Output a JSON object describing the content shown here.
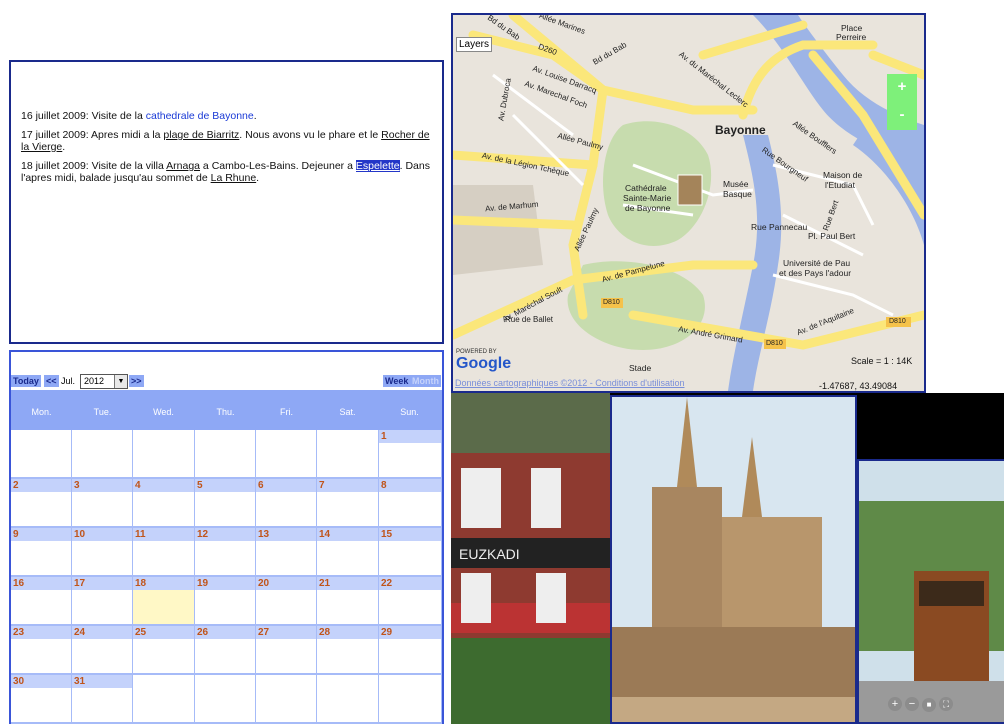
{
  "journal": {
    "entries": [
      {
        "date": "16 juillet 2009:",
        "text": " Visite de la ",
        "link": "cathedrale de Bayonne",
        "after": "."
      },
      {
        "date": "17 juillet 2009:",
        "text": " Apres midi a la ",
        "link": "plage de Biarritz",
        "after": ". Nous avons vu le phare et le ",
        "link2": "Rocher de la Vierge",
        "after2": "."
      },
      {
        "date": "18 juillet 2009:",
        "text": " Visite de la villa ",
        "link": "Arnaga",
        "after": " a Cambo-Les-Bains. Dejeuner a ",
        "link2": "Espelette",
        "after2": ". Dans l'apres midi, balade jusqu'au sommet de ",
        "link3": "La Rhune",
        "after3": "."
      }
    ]
  },
  "map": {
    "layers_label": "Layers",
    "zoom_in": "+",
    "zoom_out": "-",
    "powered_by": "POWERED BY",
    "google": "Google",
    "scale": "Scale = 1 : 14K",
    "coords": "-1.47687, 43.49084",
    "data_credit": "Données cartographiques ©2012 - Conditions d'utilisation",
    "labels": {
      "city": "Bayonne",
      "place": "Place",
      "perreire": "Perreire",
      "cathedrale": "Cathédrale",
      "sainte_marie": "Sainte-Marie",
      "de_bayonne": "de Bayonne",
      "musee": "Musée",
      "basque": "Basque",
      "maison": "Maison de",
      "etudiant": "l'Etudiat",
      "universite": "Université de Pau",
      "pays": "et des Pays l'adour",
      "stade": "Stade",
      "rue_pannecau": "Rue Pannecau",
      "pl_paul_bert": "Pl. Paul Bert"
    },
    "roads": [
      "Bd du Bab",
      "Allée Marines",
      "Bd du Bab",
      "Av. du Maréchal Leclerc",
      "Av. Louise Darracq",
      "Av. Marechal Foch",
      "Allée Paulmy",
      "Av. de la Légion Tchèque",
      "Av. de Marhum",
      "Allée Paulmy",
      "Av. de Pampelune",
      "Av. Maréchal Soult",
      "Rue de Ballet",
      "Av. André Grimard",
      "Av. de l'Aquitaine",
      "Allée Boufflers",
      "Rue Bourgneuf",
      "Rue Bert",
      "D810",
      "D810",
      "D810",
      "D260",
      "Av. Dubroca"
    ]
  },
  "calendar": {
    "today": "Today",
    "prev": "<<",
    "month": "Jul.",
    "year": "2012",
    "next": ">>",
    "week": "Week",
    "month_btn": "Month",
    "weekdays": [
      "Mon.",
      "Tue.",
      "Wed.",
      "Thu.",
      "Fri.",
      "Sat.",
      "Sun."
    ],
    "weeks": [
      [
        "",
        "",
        "",
        "",
        "",
        "",
        "1"
      ],
      [
        "2",
        "3",
        "4",
        "5",
        "6",
        "7",
        "8"
      ],
      [
        "9",
        "10",
        "11",
        "12",
        "13",
        "14",
        "15"
      ],
      [
        "16",
        "17",
        "18",
        "19",
        "20",
        "21",
        "22"
      ],
      [
        "23",
        "24",
        "25",
        "26",
        "27",
        "28",
        "29"
      ],
      [
        "30",
        "31",
        "",
        "",
        "",
        "",
        ""
      ]
    ],
    "highlighted_day": "18"
  },
  "photos": {
    "controls": [
      "+",
      "−",
      "■",
      "⛶"
    ]
  },
  "colors": {
    "border_blue": "#1a2a8c",
    "calendar_blue": "#8ea8f5",
    "day_number": "#c0541a",
    "zoom_green": "#7ef07a",
    "road_yellow": "#fbe77a",
    "water": "#9db4e6"
  }
}
